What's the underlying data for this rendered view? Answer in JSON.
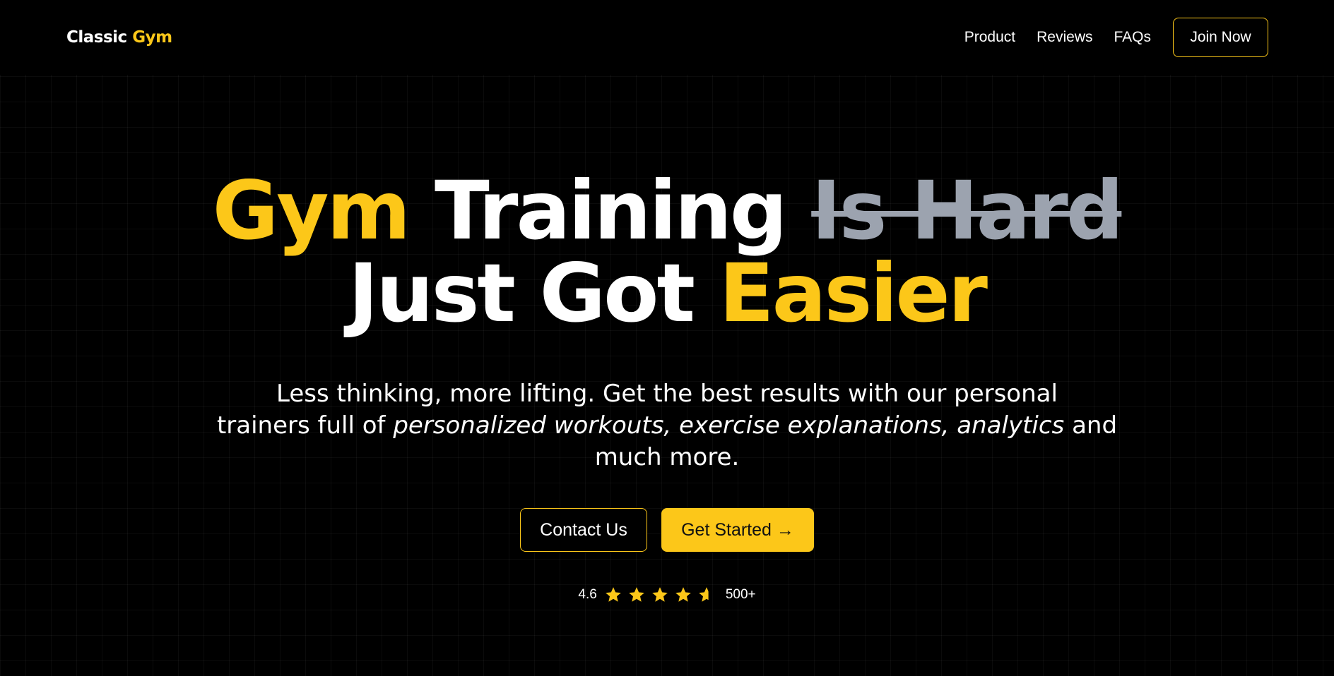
{
  "brand": {
    "name_part1": "Classic ",
    "name_part2": "Gym"
  },
  "nav": {
    "links": [
      "Product",
      "Reviews",
      "FAQs"
    ],
    "join_label": "Join Now"
  },
  "hero": {
    "headline": {
      "w1": "Gym",
      "w2": "Training",
      "w3_struck": "Is Hard",
      "w4": "Just Got",
      "w5": "Easier"
    },
    "subtext": {
      "line1": "Less thinking, more lifting. Get the best results with our personal",
      "line2_pre": "trainers full of ",
      "line2_italic": "personalized workouts, exercise explanations, analytics",
      "line2_post": " and",
      "line3": "much more."
    }
  },
  "cta": {
    "contact_label": "Contact Us",
    "start_label": "Get Started →"
  },
  "rating": {
    "score": "4.6",
    "stars": 4.6,
    "count": "500+"
  },
  "colors": {
    "accent": "#fcc719",
    "background": "#000000",
    "muted": "#9ca3af"
  }
}
